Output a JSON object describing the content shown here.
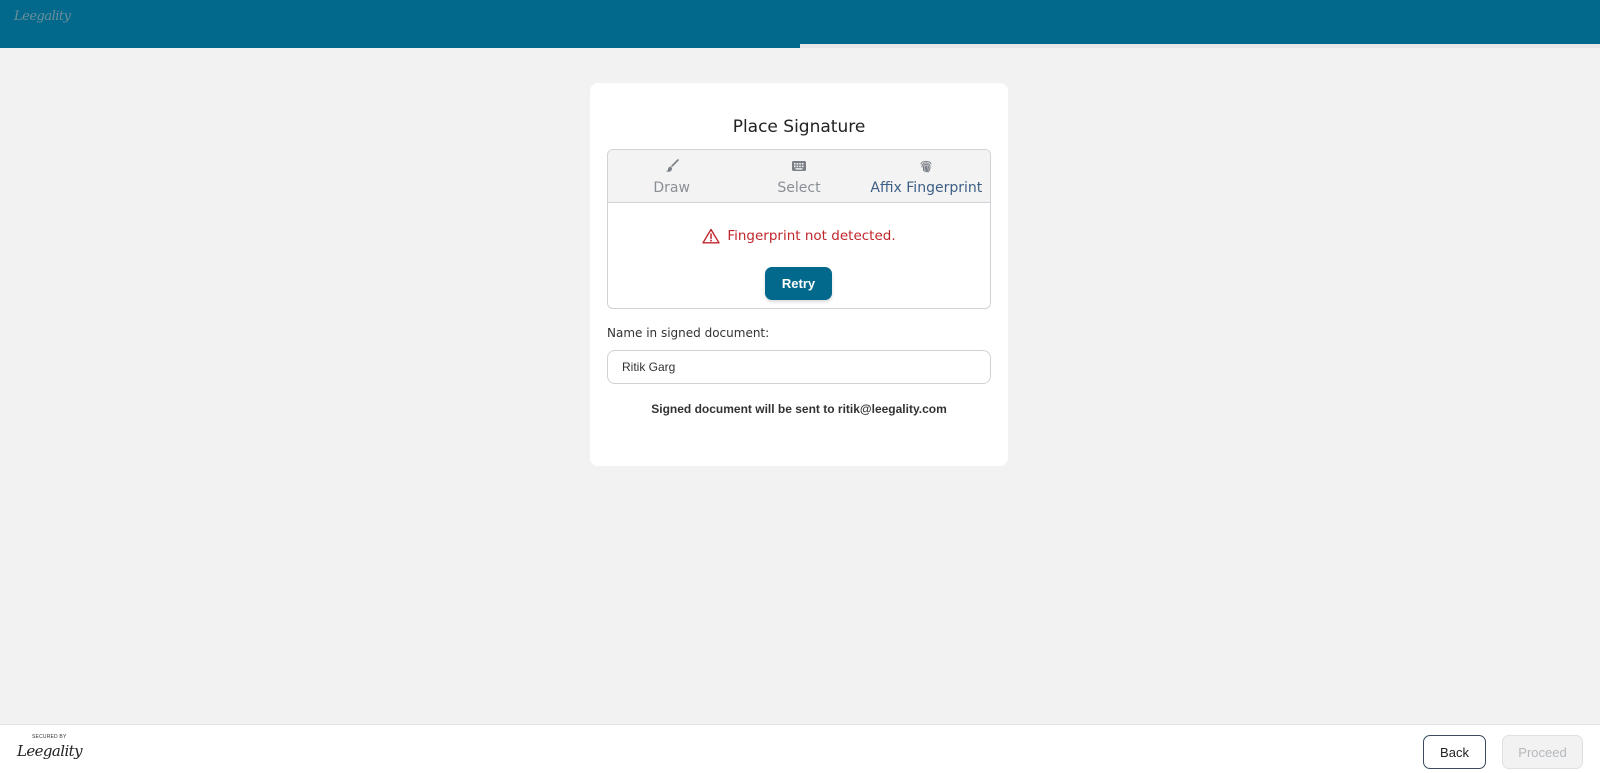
{
  "header": {
    "logo_text": "Leegality",
    "progress_fraction": 0.5
  },
  "card": {
    "title": "Place Signature",
    "tabs": [
      {
        "label": "Draw",
        "icon": "brush-icon",
        "active": false
      },
      {
        "label": "Select",
        "icon": "keyboard-icon",
        "active": false
      },
      {
        "label": "Affix Fingerprint",
        "icon": "fingerprint-icon",
        "active": true
      }
    ],
    "error": {
      "icon": "warning-triangle-icon",
      "message": "Fingerprint not detected."
    },
    "retry_label": "Retry",
    "name_field": {
      "label": "Name in signed document:",
      "value": "Ritik Garg"
    },
    "send_note": "Signed document will be sent to ritik@leegality.com"
  },
  "footer": {
    "secured_label": "SECURED BY",
    "secured_logo": "Leegality",
    "back_label": "Back",
    "proceed_label": "Proceed"
  },
  "colors": {
    "brand": "#02698c",
    "error": "#c0262b",
    "background": "#f2f2f2"
  }
}
